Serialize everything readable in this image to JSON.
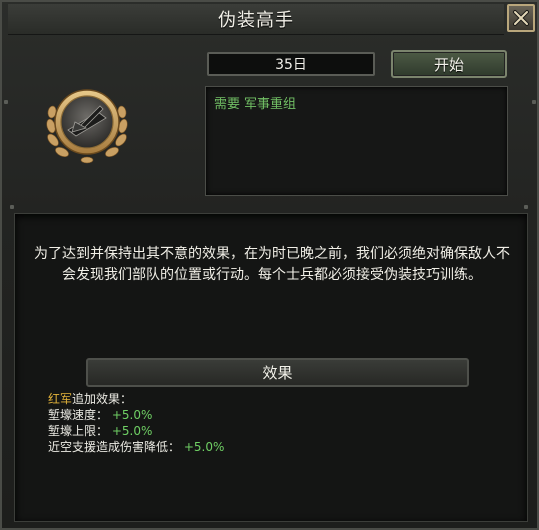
{
  "window": {
    "title": "伪装高手",
    "close_icon": "close-icon"
  },
  "header": {
    "duration": "35日",
    "start_label": "开始"
  },
  "requirements": {
    "label": "需要",
    "item": "军事重组"
  },
  "badge": {
    "icon": "tank-laurel-medal-icon"
  },
  "description": "为了达到并保持出其不意的效果，在为时已晚之前，我们必须绝对确保敌人不会发现我们部队的位置或行动。每个士兵都必须接受伪装技巧训练。",
  "effects": {
    "header": "效果",
    "faction": "红军",
    "intro": "追加效果：",
    "rows": [
      {
        "label": "堑壕速度：",
        "value": "+5.0%"
      },
      {
        "label": "堑壕上限：",
        "value": "+5.0%"
      },
      {
        "label": "近空支援造成伤害降低：",
        "value": "+5.0%"
      }
    ]
  },
  "colors": {
    "positive": "#6fcf64",
    "faction": "#e2b23a",
    "requirement": "#72c065"
  }
}
